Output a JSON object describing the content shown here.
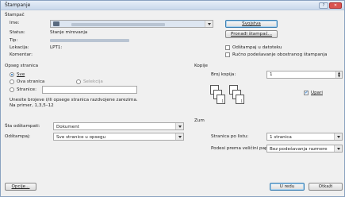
{
  "window": {
    "title": "Štampanje"
  },
  "printer": {
    "group_label": "Štampač",
    "name_label": "Ime:",
    "status_label": "Status:",
    "status_value": "Stanje mirovanja",
    "type_label": "Tip:",
    "location_label": "Lokacija:",
    "location_value": "LPT1:",
    "comment_label": "Komentar:",
    "properties_button": "Svojstva",
    "find_printer_button": "Pronađi štampač...",
    "print_to_file_label": "Odštampaj u datoteku",
    "manual_duplex_label": "Ručno podešavanje obostranog štampanja"
  },
  "page_range": {
    "label": "Opseg stranica",
    "all_label": "Sve",
    "current_label": "Ova stranica",
    "selection_label": "Selekcija",
    "pages_label": "Stranice:",
    "pages_value": "",
    "hint": "Unesite brojeve i/ili opsege stranica razdvojene zarezima. Na primer, 1,3,5–12"
  },
  "copies": {
    "label": "Kopije",
    "count_label": "Broj kopija:",
    "count_value": "1",
    "collate_label": "Upari",
    "page_numbers": [
      "1",
      "2",
      "3"
    ]
  },
  "print_what": {
    "label": "Šta odštampati:",
    "value": "Dokument"
  },
  "print": {
    "label": "Odštampaj:",
    "value": "Sve stranice u opsegu"
  },
  "zoom": {
    "label": "Zum",
    "pages_per_sheet_label": "Stranica po listu:",
    "pages_per_sheet_value": "1 stranica",
    "scale_label": "Podesi prema veličini papira:",
    "scale_value": "Bez podešavanja razmere"
  },
  "footer": {
    "options_button": "Opcije...",
    "ok_button": "U redu",
    "cancel_button": "Otkaži"
  }
}
